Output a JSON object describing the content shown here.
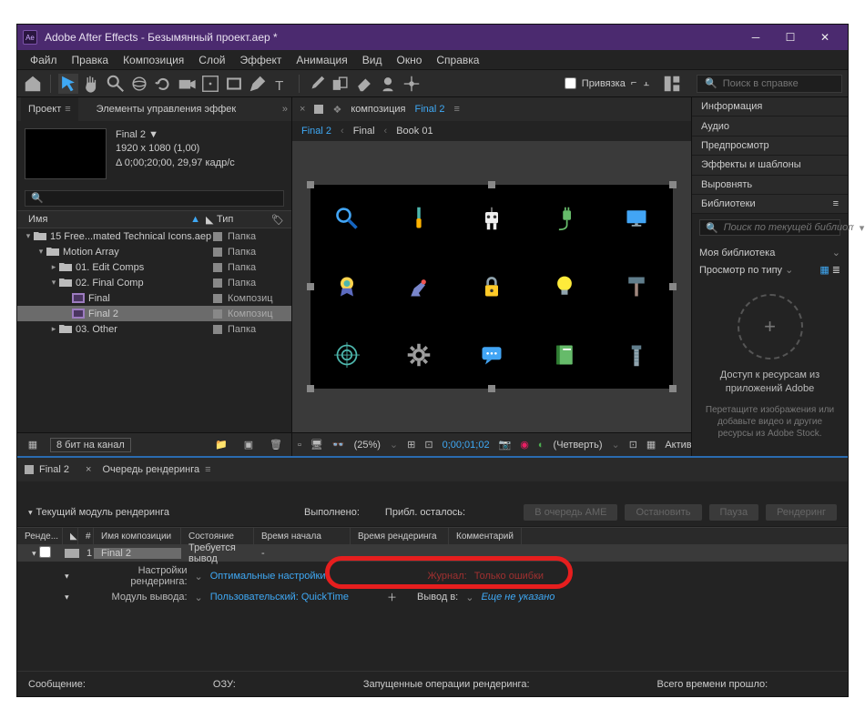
{
  "window": {
    "title": "Adobe After Effects - Безымянный проект.aep *"
  },
  "menu": [
    "Файл",
    "Правка",
    "Композиция",
    "Слой",
    "Эффект",
    "Анимация",
    "Вид",
    "Окно",
    "Справка"
  ],
  "toolbar": {
    "snap_label": "Привязка",
    "search_placeholder": "Поиск в справке"
  },
  "project": {
    "tab_project": "Проект",
    "tab_controls": "Элементы управления эффек",
    "active_name": "Final 2 ▼",
    "resolution": "1920 x 1080 (1,00)",
    "duration": "Δ 0;00;20;00, 29,97 кадр/с",
    "col_name": "Имя",
    "col_type": "Тип",
    "tree": [
      {
        "indent": 0,
        "twisty": "▾",
        "icon": "folder",
        "name": "15 Free...mated Technical Icons.aep",
        "type": "Папка"
      },
      {
        "indent": 1,
        "twisty": "▾",
        "icon": "folder",
        "name": "Motion Array",
        "type": "Папка"
      },
      {
        "indent": 2,
        "twisty": "▸",
        "icon": "folder",
        "name": "01. Edit Comps",
        "type": "Папка"
      },
      {
        "indent": 2,
        "twisty": "▾",
        "icon": "folder",
        "name": "02. Final Comp",
        "type": "Папка"
      },
      {
        "indent": 3,
        "twisty": "",
        "icon": "comp",
        "name": "Final",
        "type": "Композиц"
      },
      {
        "indent": 3,
        "twisty": "",
        "icon": "comp",
        "name": "Final 2",
        "type": "Композиц",
        "sel": true
      },
      {
        "indent": 2,
        "twisty": "▸",
        "icon": "folder",
        "name": "03. Other",
        "type": "Папка"
      }
    ],
    "footer_bpc": "8 бит на канал"
  },
  "composition": {
    "tab_label": "композиция",
    "tab_active": "Final 2",
    "crumbs": [
      "Final 2",
      "Final",
      "Book 01"
    ],
    "footer": {
      "zoom": "(25%)",
      "timecode": "0;00;01;02",
      "quality": "(Четверть)",
      "view": "Активная"
    }
  },
  "right_panels": [
    "Информация",
    "Аудио",
    "Предпросмотр",
    "Эффекты и шаблоны",
    "Выровнять"
  ],
  "libraries": {
    "title": "Библиотеки",
    "search_placeholder": "Поиск по текущей библиот",
    "my_library": "Моя библиотека",
    "view_by": "Просмотр по типу",
    "cta_title": "Доступ к ресурсам из приложений Adobe",
    "cta_sub": "Перетащите изображения или добавьте видео и другие ресурсы из Adobe Stock."
  },
  "render_queue": {
    "tab_comp": "Final 2",
    "tab_queue": "Очередь рендеринга",
    "module_label": "Текущий модуль рендеринга",
    "done": "Выполнено:",
    "remaining": "Прибл. осталось:",
    "btn_ame": "В очередь AME",
    "btn_stop": "Остановить",
    "btn_pause": "Пауза",
    "btn_render": "Рендеринг",
    "cols": {
      "render": "Ренде...",
      "idx": "#",
      "comp": "Имя композиции",
      "state": "Состояние",
      "start": "Время начала",
      "elapsed": "Время рендеринга",
      "comment": "Комментарий"
    },
    "row": {
      "idx": "1",
      "comp": "Final 2",
      "state": "Требуется вывод",
      "start": "-"
    },
    "settings_lbl": "Настройки рендеринга:",
    "settings_val": "Оптимальные настройки",
    "output_lbl": "Модуль вывода:",
    "output_val": "Пользовательский: QuickTime",
    "log_lbl": "Журнал:",
    "log_val": "Только ошибки",
    "dest_lbl": "Вывод в:",
    "dest_val": "Еще не указано",
    "status": {
      "msg": "Сообщение:",
      "ram": "ОЗУ:",
      "ops": "Запущенные операции рендеринга:",
      "total": "Всего времени прошло:"
    }
  },
  "chart_data": null
}
